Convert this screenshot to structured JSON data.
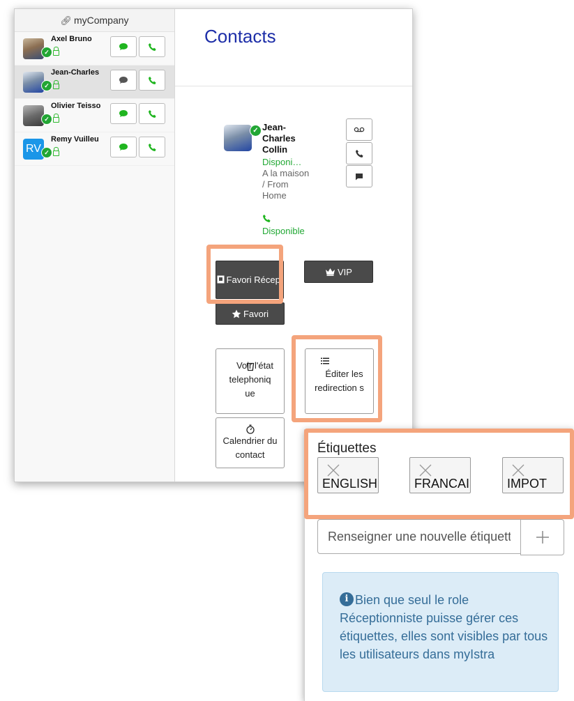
{
  "sidebar": {
    "company": "myCompany",
    "contacts": [
      {
        "name": "Axel Bruno",
        "avatar": "photo",
        "active": false
      },
      {
        "name": "Jean-Charles",
        "avatar": "photo",
        "active": true
      },
      {
        "name": "Olivier Teisso",
        "avatar": "photo",
        "active": false
      },
      {
        "name": "Remy Vuilleu",
        "avatar": "RV",
        "active": false
      }
    ]
  },
  "main": {
    "title": "Contacts",
    "card": {
      "name": "Jean-Charles Collin",
      "status": "Disponi…",
      "location": "A la maison / From Home",
      "availability": "Disponible"
    },
    "buttons": {
      "favori_recep": "Favori Récep.",
      "vip": "VIP",
      "favori": "Favori",
      "voir_etat": "Voir l'état telephoniq ue",
      "editer_redirections": "Éditer les redirection s",
      "calendrier": "Calendrier du contact"
    }
  },
  "tags_panel": {
    "title": "Étiquettes",
    "tags": [
      "ENGLISH",
      "FRANCAIS",
      "IMPOT"
    ],
    "new_tag_placeholder": "Renseigner une nouvelle étiquette",
    "info": "Bien que seul le role Réceptionniste puisse gérer ces étiquettes, elles sont visibles par tous les utilisateurs dans myIstra"
  },
  "colors": {
    "accent_blue": "#1d2ea8",
    "status_green": "#22a634",
    "highlight": "#f4a47c",
    "dark_button": "#4a4a4a",
    "info_text": "#356d98"
  },
  "icons": [
    "link-icon",
    "chat-icon",
    "phone-icon",
    "voicemail-icon",
    "contact-card-icon",
    "crown-icon",
    "star-icon",
    "phone-handset-icon",
    "list-icon",
    "stopwatch-icon",
    "close-icon",
    "plus-icon",
    "info-icon",
    "lock-icon",
    "check-icon"
  ]
}
